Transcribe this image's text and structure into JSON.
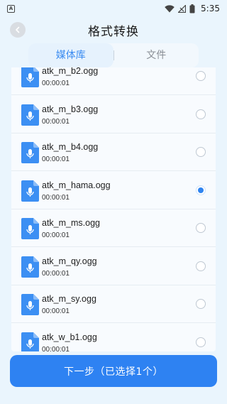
{
  "status_bar": {
    "notification_icon": "a-letter-icon",
    "time": "5:35"
  },
  "header": {
    "title": "格式转换",
    "back_icon": "chevron-left-icon"
  },
  "tabs": [
    {
      "label": "媒体库",
      "active": true
    },
    {
      "label": "文件",
      "active": false
    }
  ],
  "files": [
    {
      "name": "atk_m_b2.ogg",
      "duration": "00:00:01",
      "selected": false
    },
    {
      "name": "atk_m_b3.ogg",
      "duration": "00:00:01",
      "selected": false
    },
    {
      "name": "atk_m_b4.ogg",
      "duration": "00:00:01",
      "selected": false
    },
    {
      "name": "atk_m_hama.ogg",
      "duration": "00:00:01",
      "selected": true
    },
    {
      "name": "atk_m_ms.ogg",
      "duration": "00:00:01",
      "selected": false
    },
    {
      "name": "atk_m_qy.ogg",
      "duration": "00:00:01",
      "selected": false
    },
    {
      "name": "atk_m_sy.ogg",
      "duration": "00:00:01",
      "selected": false
    },
    {
      "name": "atk_w_b1.ogg",
      "duration": "00:00:01",
      "selected": false
    }
  ],
  "next_button": {
    "label": "下一步（已选择1个）"
  },
  "colors": {
    "accent": "#2e82f2",
    "background": "#eaf5fd"
  }
}
